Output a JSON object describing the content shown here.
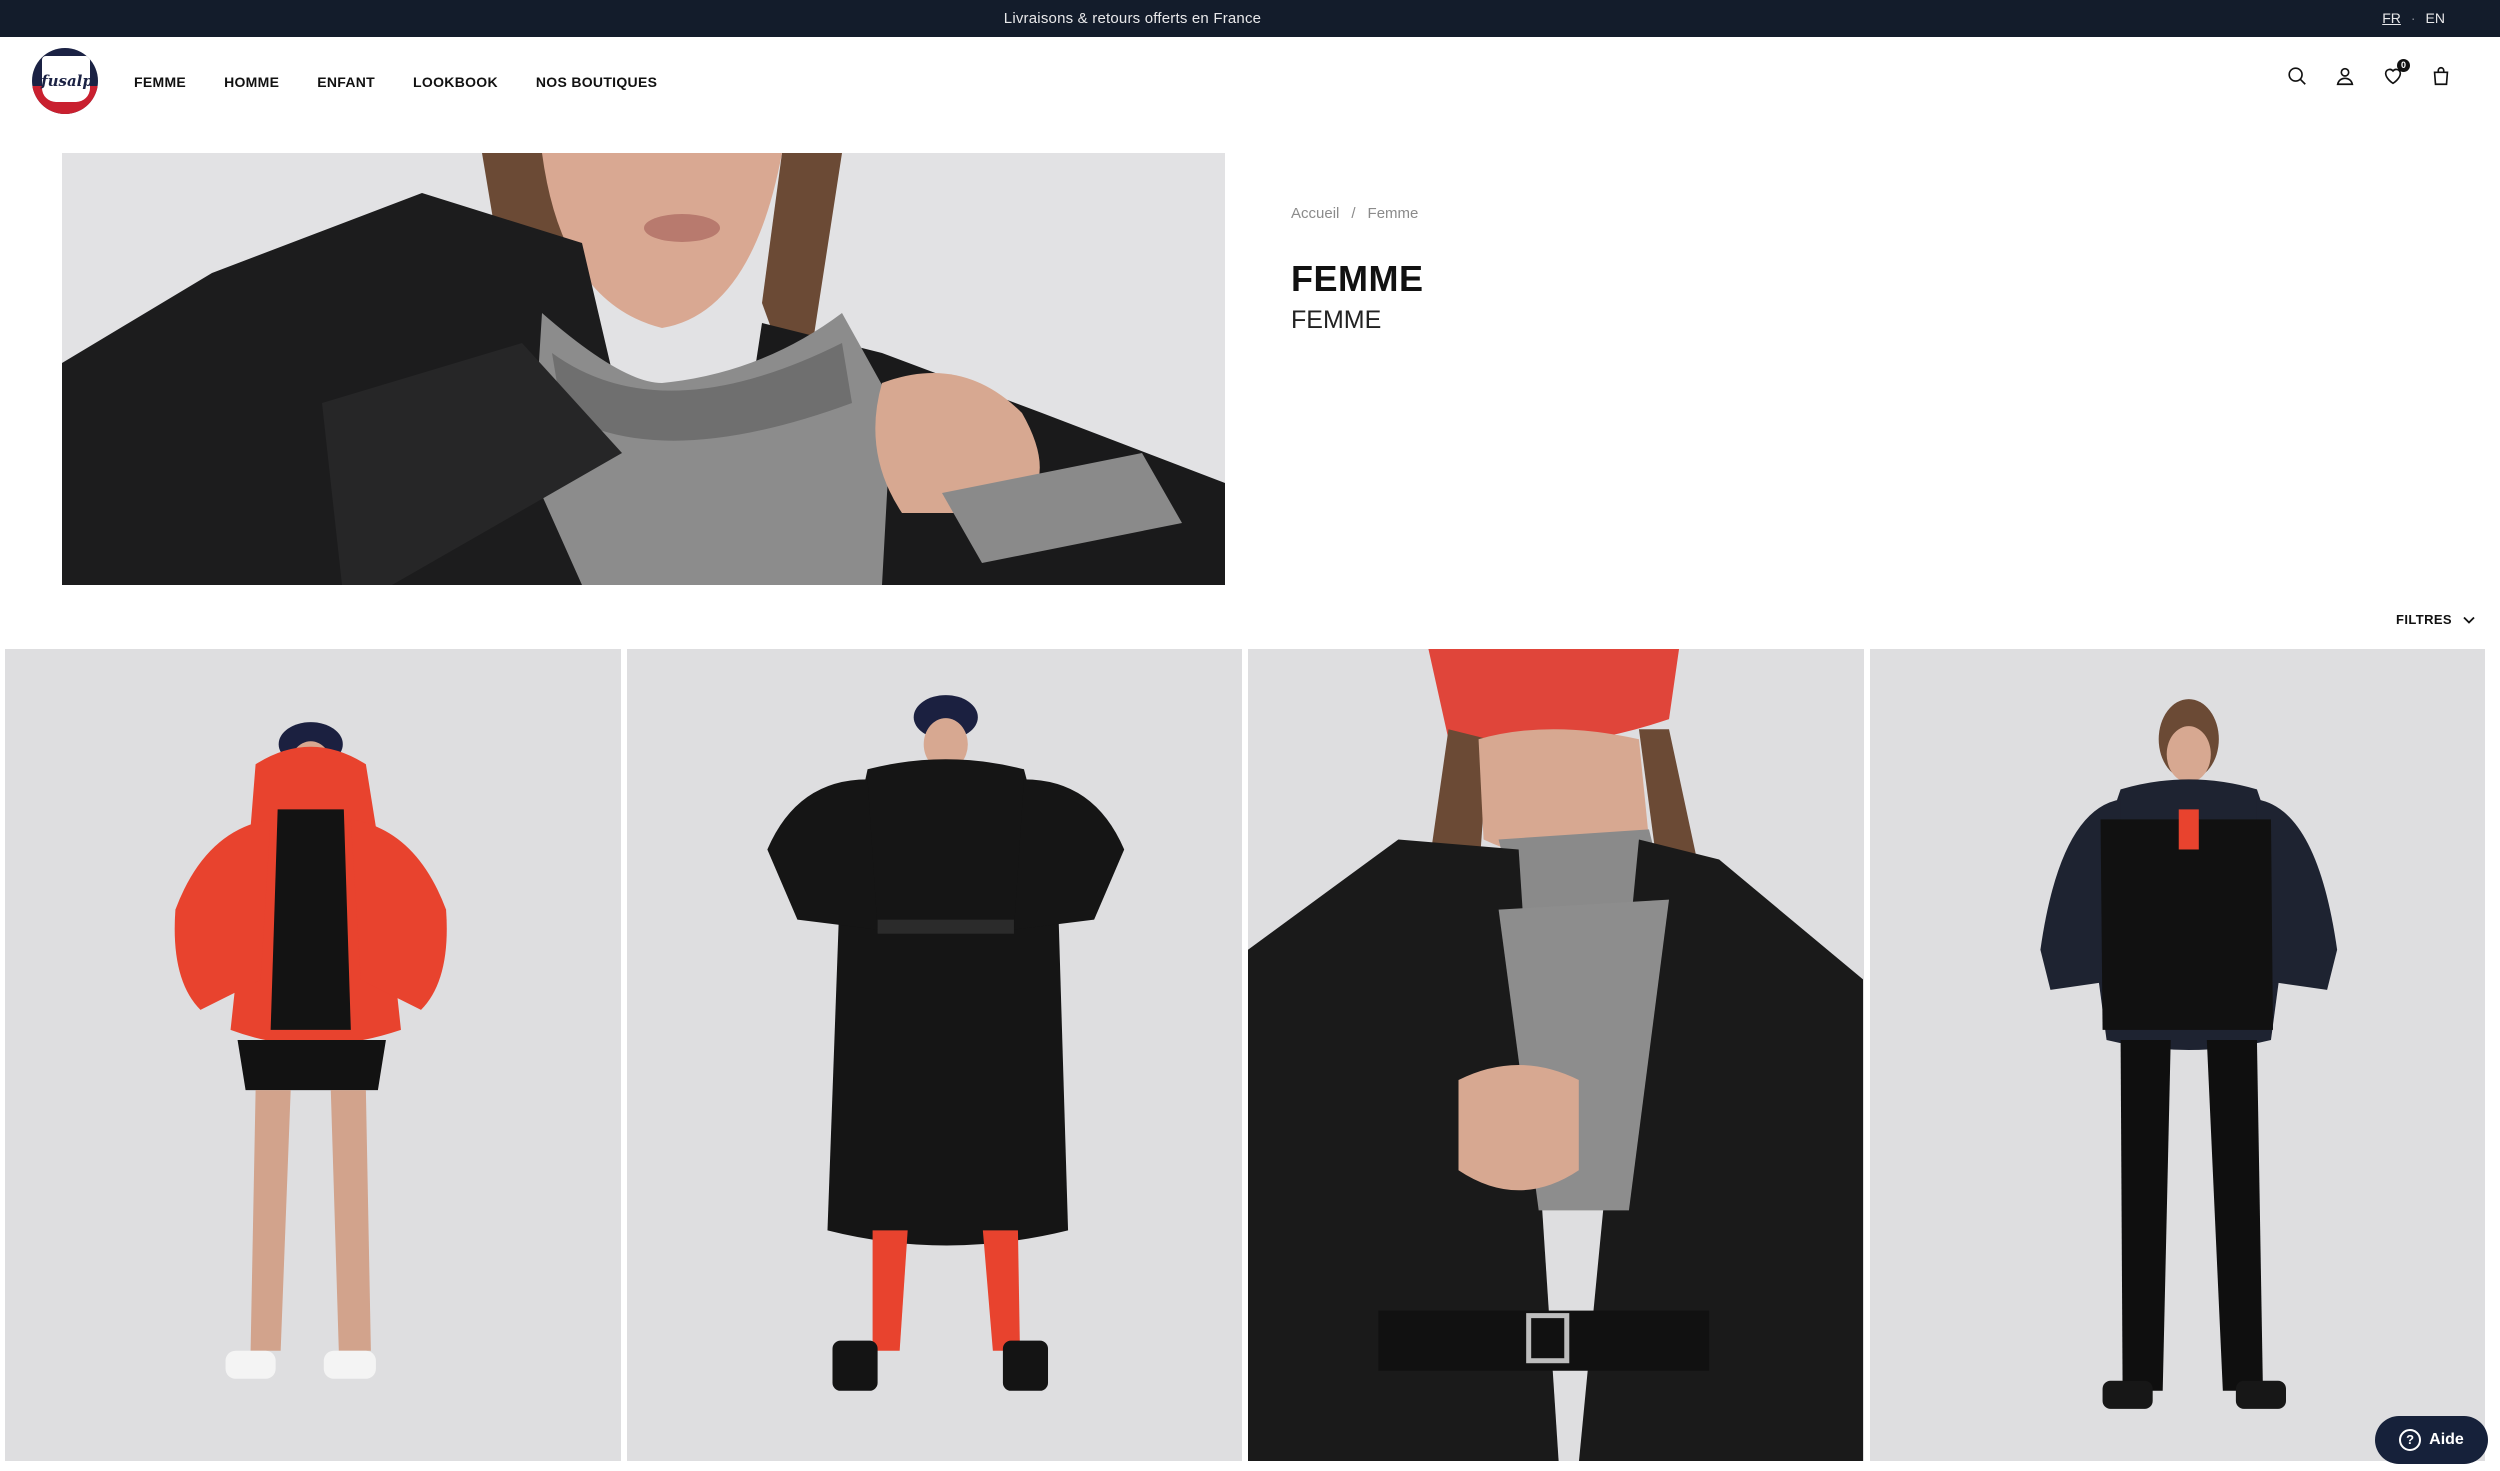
{
  "announcement": "Livraisons & retours offerts en France",
  "languages": {
    "fr": "FR",
    "separator": "·",
    "en": "EN"
  },
  "brand": {
    "logo_text": "fusalp",
    "colors": {
      "navy": "#1b2244",
      "red": "#c9202f"
    }
  },
  "nav": [
    "FEMME",
    "HOMME",
    "ENFANT",
    "LOOKBOOK",
    "NOS BOUTIQUES"
  ],
  "header_icons": {
    "search": "search-icon",
    "account": "user-icon",
    "wishlist": "heart-icon",
    "wishlist_count": "0",
    "cart": "bag-icon"
  },
  "breadcrumb": {
    "home": "Accueil",
    "separator": "/",
    "current": "Femme"
  },
  "category": {
    "title": "FEMME",
    "subtitle": "FEMME"
  },
  "filters_label": "FILTRES",
  "products": [
    {
      "image": "woman in red puffer jacket and black shorts"
    },
    {
      "image": "woman in long black belted puffer coat"
    },
    {
      "image": "woman in red cap and black belted coat"
    },
    {
      "image": "woman in navy jacket with black fur gilet"
    }
  ],
  "help_label": "Aide"
}
